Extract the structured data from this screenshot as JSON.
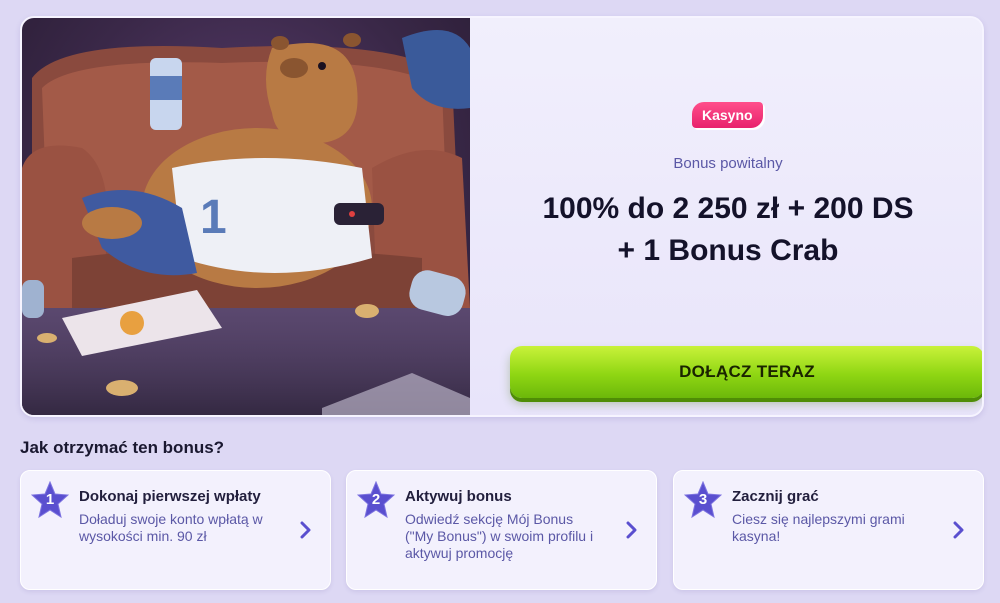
{
  "hero": {
    "badge": "Kasyno",
    "subtitle": "Bonus powitalny",
    "title_line1": "100% do 2 250 zł + 200 DS",
    "title_line2": "+ 1 Bonus Crab",
    "cta_label": "DOŁĄCZ TERAZ",
    "image": "capybara-on-couch-illustration"
  },
  "how": {
    "title": "Jak otrzymać ten bonus?",
    "steps": [
      {
        "num": "1",
        "title": "Dokonaj pierwszej wpłaty",
        "text": "Doładuj swoje konto wpłatą w wysokości min. 90 zł"
      },
      {
        "num": "2",
        "title": "Aktywuj bonus",
        "text": "Odwiedź sekcję Mój Bonus (\"My Bonus\") w swoim profilu i aktywuj promocję"
      },
      {
        "num": "3",
        "title": "Zacznij grać",
        "text": "Ciesz się najlepszymi grami kasyna!"
      }
    ]
  },
  "colors": {
    "accent": "#5b58a6",
    "cta": "#8fd613",
    "badge": "#e8226c",
    "star": "#5a4fcf"
  }
}
